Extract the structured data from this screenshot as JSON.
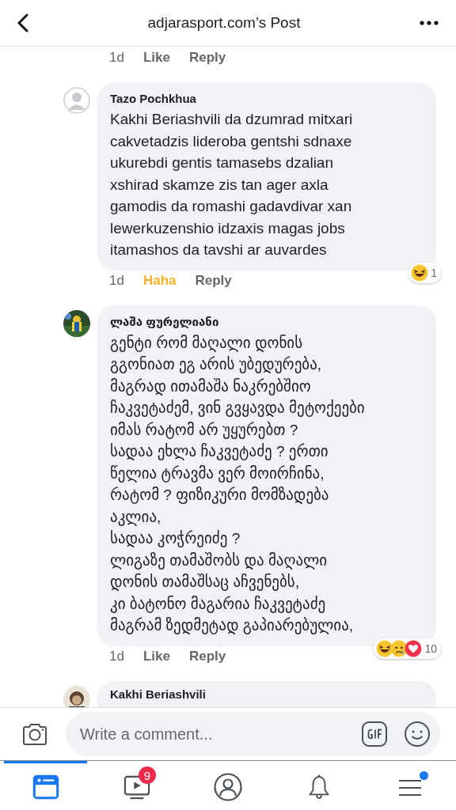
{
  "header": {
    "title": "adjarasport.com’s Post"
  },
  "comments": [
    {
      "kind": "tail",
      "time": "1d",
      "reaction_label": "Like",
      "reacted": false,
      "reply": "Reply"
    },
    {
      "kind": "full",
      "avatar": {
        "kind": "default"
      },
      "author": "Tazo Pochkhua",
      "body": "Kakhi Beriashvili  da dzumrad mitxari\ncakvetadzis lideroba gentshi sdnaxe\nukurebdi gentis tamasebs dzalian\nxshirad skamze zis tan ager axla\ngamodis da romashi gadavdivar xan\nlewerkuzenshio idzaxis magas jobs\nitamashos  da tavshi ar auvardes",
      "time": "1d",
      "reaction_label": "Haha",
      "reacted": true,
      "reply": "Reply",
      "reactions": [
        {
          "kind": "haha"
        }
      ],
      "reaction_count": "1"
    },
    {
      "kind": "full",
      "avatar": {
        "kind": "picture"
      },
      "author": "ლაშა ფურელიანი",
      "body": "გენტი რომ მაღალი დონის\nგგონიათ ეგ არის უბედურება,\nმაგრად ითამაშა ნაკრებშიო\nჩაკვეტაძემ,  ვინ გვყავდა მეტოქეები\nიმას რატომ არ უყურებთ ?\nსადაა ეხლა ჩაკვეტაძე ? ერთი\nწელია ტრავმა ვერ მოირჩინა,\nრატომ ? ფიზიკური მომზადება\nაკლია,\nსადაა კოჭრეიძე ?\nლიგაზე თამაშობს და მაღალი\nდონის თამაშსაც აჩვენებს,\nკი ბატონო მაგარია ჩაკვეტაძე\nმაგრამ ზედმეტად გაპიარებულია,",
      "time": "1d",
      "reaction_label": "Like",
      "reacted": false,
      "reply": "Reply",
      "reactions": [
        {
          "kind": "haha"
        },
        {
          "kind": "sad"
        },
        {
          "kind": "love"
        }
      ],
      "reaction_count": "10"
    },
    {
      "kind": "cut",
      "avatar": {
        "kind": "picture"
      },
      "author": "Kakhi Beriashvili"
    }
  ],
  "composer": {
    "placeholder": "Write a comment..."
  },
  "tabs": [
    {
      "kind": "feed",
      "selected": true
    },
    {
      "kind": "video",
      "selected": false,
      "badge": "9"
    },
    {
      "kind": "profile",
      "selected": false
    },
    {
      "kind": "bell",
      "selected": false
    },
    {
      "kind": "menu",
      "selected": false,
      "dot": true
    }
  ]
}
